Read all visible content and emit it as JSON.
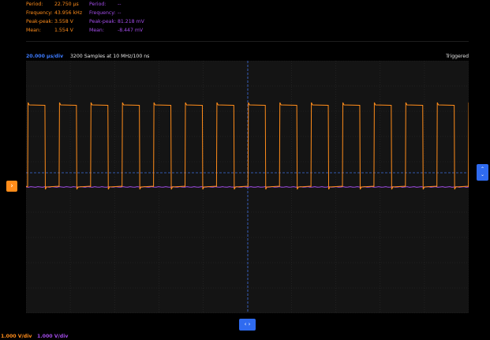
{
  "measurements": {
    "ch1": {
      "color": "#ff8c1a",
      "rows": [
        {
          "label": "Period:",
          "value": "22.750 µs"
        },
        {
          "label": "Frequency:",
          "value": "43.956 kHz"
        },
        {
          "label": "Peak-peak:",
          "value": "3.558 V"
        },
        {
          "label": "Mean:",
          "value": "1.554 V"
        }
      ]
    },
    "ch2": {
      "color": "#a24ce8",
      "rows": [
        {
          "label": "Period:",
          "value": "--"
        },
        {
          "label": "Frequency:",
          "value": "--"
        },
        {
          "label": "Peak-peak:",
          "value": "81.218 mV"
        },
        {
          "label": "Mean:",
          "value": "-8.447 mV"
        }
      ]
    }
  },
  "status": {
    "timebase": "20.000 µs/div",
    "samples": "3200 Samples at 10 MHz/100 ns",
    "trigger": "Triggered"
  },
  "markers": {
    "trigger_glyph": "›",
    "level_glyph_up": "⌃",
    "level_glyph_down": "⌄",
    "hpos_glyph": "‹ ›"
  },
  "channels": {
    "ch1_vdiv": "1.000 V/div",
    "ch2_vdiv": "1.000 V/div"
  },
  "colors": {
    "background": "#000000",
    "grid_bg": "#141414",
    "grid_line": "#2b2b2b",
    "ch1": "#ff8c1a",
    "ch2": "#a24ce8",
    "accent": "#2f6bf0"
  }
}
